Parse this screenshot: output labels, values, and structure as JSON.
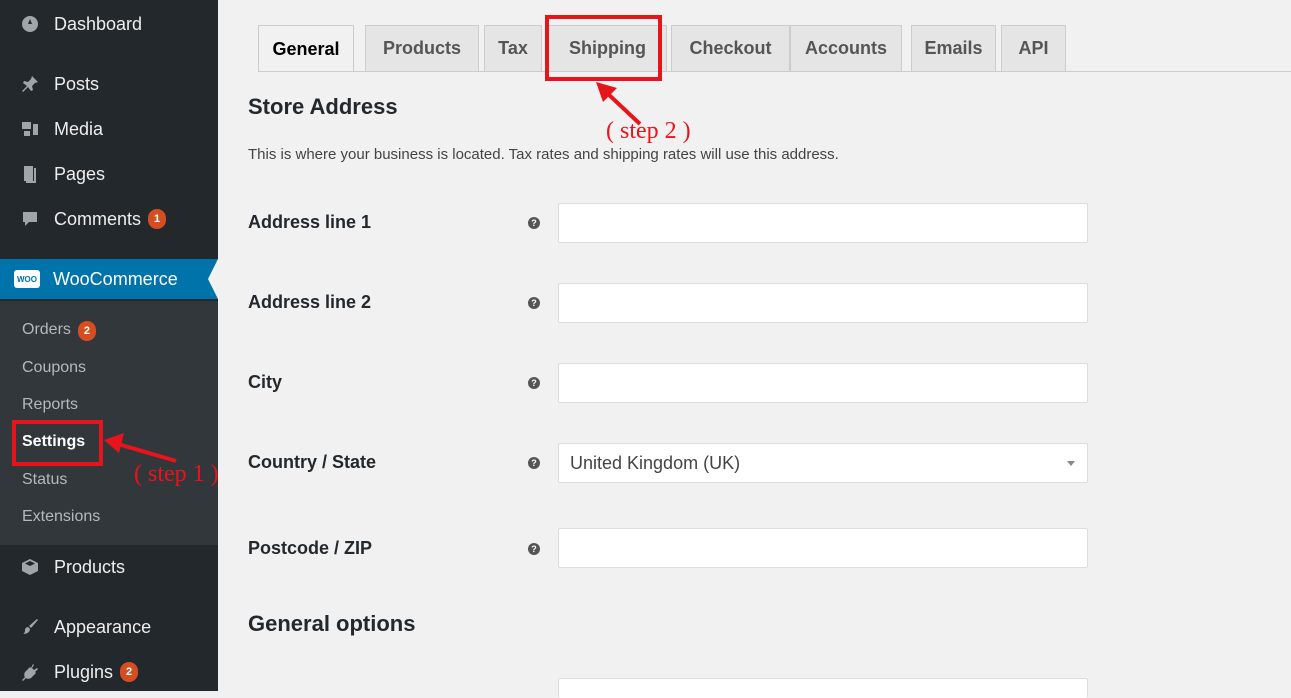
{
  "sidebar": {
    "items": [
      {
        "label": "Dashboard",
        "icon": "dashboard-icon"
      },
      {
        "label": "Posts",
        "icon": "pin-icon"
      },
      {
        "label": "Media",
        "icon": "media-icon"
      },
      {
        "label": "Pages",
        "icon": "pages-icon"
      },
      {
        "label": "Comments",
        "icon": "comment-icon",
        "badge": "1"
      },
      {
        "label": "WooCommerce",
        "icon": "woo-icon",
        "logo_text": "WOO"
      },
      {
        "label": "Products",
        "icon": "box-icon"
      },
      {
        "label": "Appearance",
        "icon": "brush-icon"
      },
      {
        "label": "Plugins",
        "icon": "plug-icon",
        "badge": "2"
      }
    ],
    "submenu": [
      {
        "label": "Orders",
        "badge": "2"
      },
      {
        "label": "Coupons"
      },
      {
        "label": "Reports"
      },
      {
        "label": "Settings",
        "current": true
      },
      {
        "label": "Status"
      },
      {
        "label": "Extensions"
      }
    ]
  },
  "tabs": [
    "General",
    "Products",
    "Tax",
    "Shipping",
    "Checkout",
    "Accounts",
    "Emails",
    "API"
  ],
  "active_tab": "General",
  "store_address": {
    "title": "Store Address",
    "description": "This is where your business is located. Tax rates and shipping rates will use this address.",
    "fields": [
      {
        "label": "Address line 1",
        "value": ""
      },
      {
        "label": "Address line 2",
        "value": ""
      },
      {
        "label": "City",
        "value": ""
      },
      {
        "label": "Country / State",
        "value": "United Kingdom (UK)",
        "type": "select"
      },
      {
        "label": "Postcode / ZIP",
        "value": ""
      }
    ]
  },
  "general_options": {
    "title": "General options"
  },
  "help_glyph": "?",
  "annotations": {
    "step1": "( step 1 )",
    "step2": "( step 2 )",
    "color": "#e8141b"
  },
  "colors": {
    "sidebar": "#23282d",
    "submenu": "#32373c",
    "active": "#0073aa",
    "badge": "#d54e21"
  }
}
